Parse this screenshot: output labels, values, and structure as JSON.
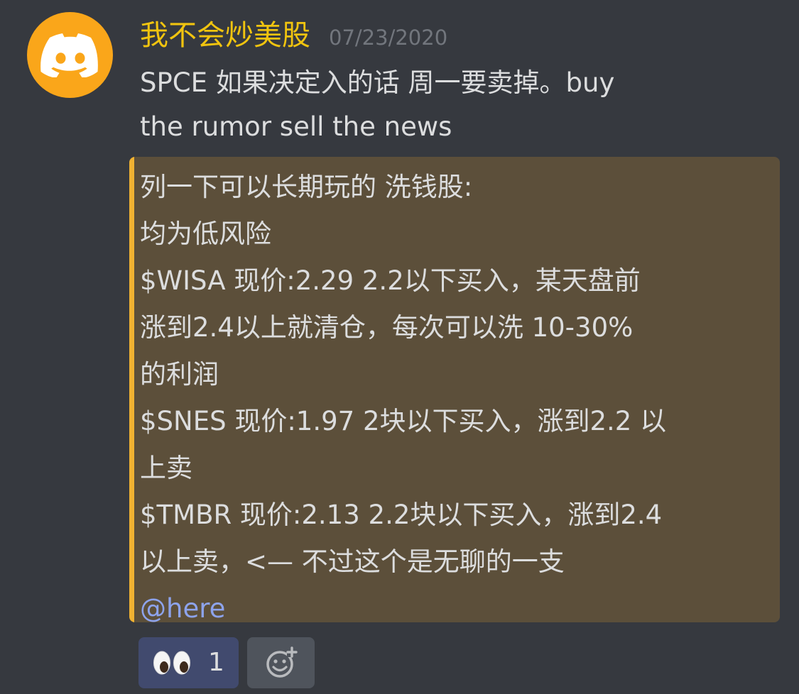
{
  "author": {
    "username": "我不会炒美股",
    "timestamp": "07/23/2020",
    "avatar_icon": "discord-logo-icon",
    "username_color": "#f1c40f"
  },
  "message": {
    "text": "SPCE 如果决定入的话 周一要卖掉。buy\nthe rumor sell the news"
  },
  "embed": {
    "accent_color": "#f0b232",
    "lines": [
      "列一下可以长期玩的 洗钱股:",
      "均为低风险",
      "$WISA 现价:2.29 2.2以下买入，某天盘前\n涨到2.4以上就清仓，每次可以洗 10-30%\n的利润",
      "$SNES 现价:1.97 2块以下买入，涨到2.2 以\n上卖",
      "$TMBR 现价:2.13 2.2块以下买入，涨到2.4\n以上卖，<— 不过这个是无聊的一支"
    ],
    "mention": "@here"
  },
  "reactions": [
    {
      "emoji": "eyes-emoji-icon",
      "count": "1"
    }
  ],
  "add_reaction_icon": "add-reaction-icon"
}
